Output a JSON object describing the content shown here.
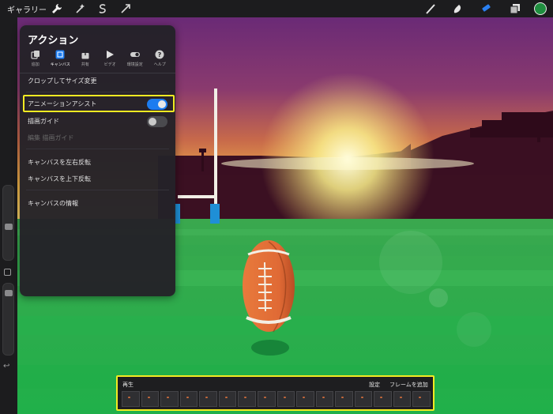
{
  "topbar": {
    "gallery_label": "ギャラリー",
    "left_icons": [
      "wrench-icon",
      "magic-wand-icon",
      "selection-s-icon",
      "transform-arrow-icon"
    ],
    "right_icons": [
      "brush-icon",
      "smudge-icon",
      "eraser-icon",
      "layers-icon"
    ],
    "color_swatch": "#1f8e3f"
  },
  "panel": {
    "title": "アクション",
    "tabs": [
      {
        "label": "追加",
        "icon": "add-icon"
      },
      {
        "label": "キャンバス",
        "icon": "canvas-icon",
        "active": true
      },
      {
        "label": "共有",
        "icon": "share-icon"
      },
      {
        "label": "ビデオ",
        "icon": "video-play-icon"
      },
      {
        "label": "環境設定",
        "icon": "preferences-toggle-icon"
      },
      {
        "label": "ヘルプ",
        "icon": "help-icon"
      }
    ],
    "items": {
      "crop_resize": "クロップしてサイズ変更",
      "animation_assist": "アニメーションアシスト",
      "drawing_guide": "描画ガイド",
      "edit_drawing_guide": "編集 描画ガイド",
      "flip_horizontal": "キャンバスを左右反転",
      "flip_vertical": "キャンバスを上下反転",
      "canvas_info": "キャンバスの情報"
    },
    "toggles": {
      "animation_assist": true,
      "drawing_guide": false
    }
  },
  "timeline": {
    "play_label": "再生",
    "settings_label": "設定",
    "add_frame_label": "フレームを追加",
    "frame_count": 16
  },
  "colors": {
    "accent_blue": "#1c7cf0",
    "highlight_yellow": "#f3ea22",
    "field_green": "#2db352",
    "ball_orange": "#e06a35"
  }
}
